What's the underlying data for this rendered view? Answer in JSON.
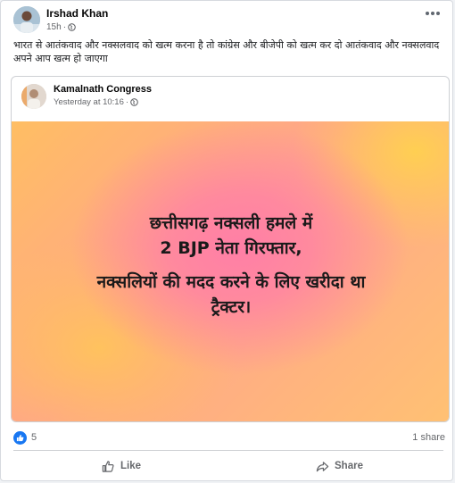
{
  "post": {
    "author": "Irshad Khan",
    "time": "15h",
    "separator": "·",
    "text": "भारत से आतंकवाद और नक्सलवाद को खत्म करना है तो कांग्रेस और बीजेपी को खत्म कर दो आतंकवाद और नक्सलवाद अपने आप खत्म हो जाएगा"
  },
  "shared": {
    "page_name": "Kamalnath Congress",
    "time": "Yesterday at 10:16",
    "separator": "·",
    "banner_lines": [
      "छत्तीसगढ़ नक्सली हमले में",
      "2 BJP नेता गिरफ्तार,",
      "नक्सलियों की मदद करने के लिए खरीदा था",
      "ट्रैक्टर।"
    ]
  },
  "stats": {
    "likes": "5",
    "shares": "1 share"
  },
  "actions": {
    "like_label": "Like",
    "share_label": "Share"
  },
  "colors": {
    "accent": "#1877f2",
    "muted_text": "#65676b"
  }
}
